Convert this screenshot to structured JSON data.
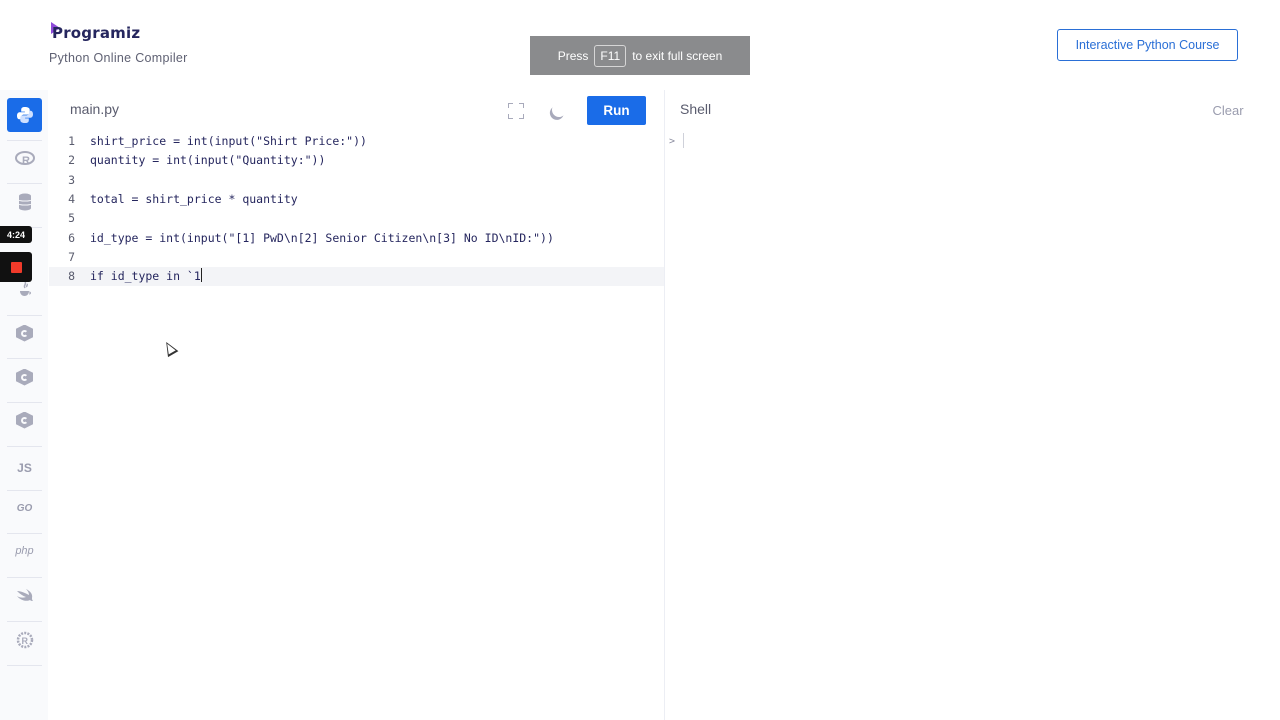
{
  "header": {
    "logo_text": "Programiz",
    "subtitle": "Python Online Compiler",
    "fullscreen_notice": {
      "before": "Press",
      "key": "F11",
      "after": "to exit full screen"
    },
    "course_button": "Interactive Python Course"
  },
  "sidebar": {
    "timer": "4:24",
    "items": [
      {
        "icon": "python-icon"
      },
      {
        "icon": "r-icon"
      },
      {
        "icon": "sql-icon"
      },
      {
        "icon": "java-icon"
      },
      {
        "icon": "c-icon"
      },
      {
        "icon": "cpp-icon"
      },
      {
        "icon": "csharp-icon"
      },
      {
        "icon": "js-icon",
        "label": "JS"
      },
      {
        "icon": "go-icon",
        "label": "GO"
      },
      {
        "icon": "php-icon",
        "label": "php"
      },
      {
        "icon": "swift-icon"
      },
      {
        "icon": "rust-icon"
      }
    ],
    "colors": {
      "active": "#1a6ce8",
      "record": "#f03a2a"
    }
  },
  "editor": {
    "file_name": "main.py",
    "run_label": "Run",
    "active_line": 8,
    "lines": [
      "shirt_price = int(input(\"Shirt Price:\"))",
      "quantity = int(input(\"Quantity:\"))",
      "",
      "total = shirt_price * quantity",
      "",
      "id_type = int(input(\"[1] PwD\\n[2] Senior Citizen\\n[3] No ID\\nID:\"))",
      "",
      "if id_type in `1"
    ]
  },
  "shell": {
    "title": "Shell",
    "clear_label": "Clear",
    "prompt": ">"
  }
}
